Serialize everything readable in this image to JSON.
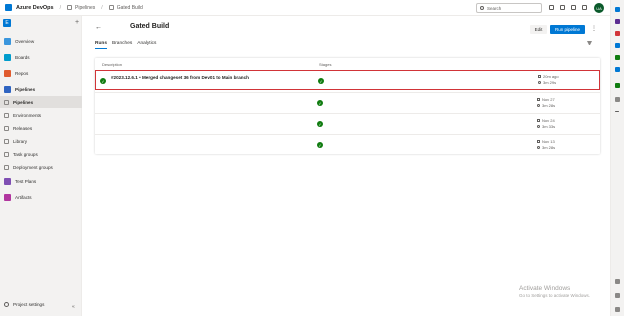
{
  "topbar": {
    "brand": "Azure DevOps",
    "breadcrumbs": [
      "Pipelines",
      "Gated Build"
    ],
    "search_placeholder": "Search",
    "avatar_initials": "UA"
  },
  "sidebar": {
    "org_initial": "E",
    "items": [
      {
        "label": "Overview",
        "icon": "overview-icon",
        "color": "#3a96dd"
      },
      {
        "label": "Boards",
        "icon": "boards-icon",
        "color": "#009ccc"
      },
      {
        "label": "Repos",
        "icon": "repos-icon",
        "color": "#e05b2e"
      },
      {
        "label": "Pipelines",
        "icon": "pipelines-icon",
        "color": "#2f64c1"
      },
      {
        "label": "Pipelines",
        "icon": "pipelines-sub-icon",
        "sub": true
      },
      {
        "label": "Environments",
        "icon": "environments-icon",
        "sub": true
      },
      {
        "label": "Releases",
        "icon": "releases-icon",
        "sub": true
      },
      {
        "label": "Library",
        "icon": "library-icon",
        "sub": true
      },
      {
        "label": "Task groups",
        "icon": "task-groups-icon",
        "sub": true
      },
      {
        "label": "Deployment groups",
        "icon": "deployment-groups-icon",
        "sub": true
      },
      {
        "label": "Test Plans",
        "icon": "test-plans-icon",
        "color": "#7f4fb3"
      },
      {
        "label": "Artifacts",
        "icon": "artifacts-icon",
        "color": "#b1369f"
      }
    ],
    "settings_label": "Project settings"
  },
  "main": {
    "title": "Gated Build",
    "edit_label": "Edit",
    "run_label": "Run pipeline",
    "tabs": [
      "Runs",
      "Branches",
      "Analytics"
    ],
    "columns": {
      "description": "Description",
      "stages": "Stages"
    },
    "runs": [
      {
        "description": "#2023.12.6.1 • Merged changeset 36 from Dev01 to Main branch",
        "when": "20m ago",
        "duration": "3m 29s",
        "selected": true
      },
      {
        "description": "",
        "when": "Nov 27",
        "duration": "3m 28s"
      },
      {
        "description": "",
        "when": "Nov 24",
        "duration": "3m 33s"
      },
      {
        "description": "",
        "when": "Nov 13",
        "duration": "3m 28s"
      }
    ]
  },
  "watermark": {
    "line1": "Activate Windows",
    "line2": "Go to Settings to activate Windows."
  },
  "colors": {
    "accent": "#0078d4",
    "success": "#107c10",
    "selection": "#d13438"
  }
}
